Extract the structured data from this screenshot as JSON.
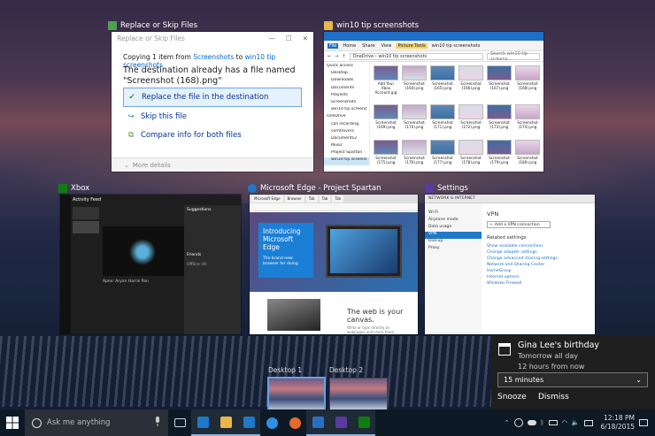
{
  "replace_dialog": {
    "caption": "Replace or Skip Files",
    "title": "Replace or Skip Files",
    "copy_prefix": "Copying 1 item from",
    "copy_from": "Screenshots",
    "copy_mid": "to",
    "copy_to": "win10 tip screenshots",
    "message": "The destination already has a file named \"Screenshot (168).png\"",
    "options": [
      "Replace the file in the destination",
      "Skip this file",
      "Compare info for both files"
    ],
    "more_details": "More details"
  },
  "explorer": {
    "caption": "win10 tip screenshots",
    "ribbon_tabs": [
      "File",
      "Home",
      "Share",
      "View",
      "Picture Tools"
    ],
    "ribbon_window_title": "win10 tip screenshots",
    "path": [
      "OneDrive",
      "win10 tip screenshots"
    ],
    "search_placeholder": "Search win10 tip screens...",
    "nav": [
      "Quick access",
      "Desktop",
      "Downloads",
      "Documents",
      "Playlists",
      "Screenshots",
      "win10 tip screens",
      "OneDrive",
      "call recording",
      "comtrovers",
      "Documents2",
      "Music",
      "Project Spartan",
      "win10 tip screens"
    ],
    "files": [
      "Add Your Xbox Account.jpg",
      "Screenshot (164).png",
      "Screenshot (165).png",
      "Screenshot (166).png",
      "Screenshot (167).png",
      "Screenshot (168).png",
      "Screenshot (169).png",
      "Screenshot (170).png",
      "Screenshot (171).png",
      "Screenshot (172).png",
      "Screenshot (173).png",
      "Screenshot (174).png",
      "Screenshot (175).png",
      "Screenshot (176).png",
      "Screenshot (177).png",
      "Screenshot (178).png",
      "Screenshot (179).png",
      "Screenshot (180).png"
    ]
  },
  "xbox": {
    "caption": "Xbox",
    "feed_title": "Activity Feed",
    "post_user": "Apex: Aryan Harris Pan",
    "side_title": "Suggestions",
    "friends_label": "Friends",
    "offline_label": "Offline (4)"
  },
  "edge": {
    "caption": "Microsoft Edge - Project Spartan",
    "tabs": [
      "Microsoft Edge",
      "Browser",
      "Tab",
      "Tab",
      "Tab"
    ],
    "hero_title": "Introducing Microsoft Edge",
    "hero_sub": "The brand new browser for doing",
    "canvas_title": "The web is your canvas.",
    "canvas_sub": "Write or type directly on webpages and share them"
  },
  "settings": {
    "caption": "Settings",
    "header": "NETWORK & INTERNET",
    "left": [
      "Wi-Fi",
      "Airplane mode",
      "Data usage",
      "VPN",
      "Dial-up",
      "Proxy"
    ],
    "selected_left": "VPN",
    "heading": "VPN",
    "add_button": "Add a VPN connection",
    "related_heading": "Related settings",
    "links": [
      "Show available connections",
      "Change adapter settings",
      "Change advanced sharing settings",
      "Network and Sharing Center",
      "HomeGroup",
      "Internet options",
      "Windows Firewall"
    ]
  },
  "desktops": [
    {
      "label": "Desktop 1",
      "current": true
    },
    {
      "label": "Desktop 2",
      "current": false
    }
  ],
  "notification": {
    "title": "Gina Lee's birthday",
    "line1": "Tomorrow all day",
    "line2": "12 hours from now",
    "snooze_value": "15 minutes",
    "snooze_button": "Snooze",
    "dismiss_button": "Dismiss"
  },
  "taskbar": {
    "search_placeholder": "Ask me anything",
    "apps": [
      {
        "icon": "task-view-icon",
        "color": "#cfd8e3"
      },
      {
        "icon": "edge-preview-icon",
        "color": "#1f78c8"
      },
      {
        "icon": "file-explorer-icon",
        "color": "#e8b84a"
      },
      {
        "icon": "store-icon",
        "color": "#1f78c8"
      },
      {
        "icon": "edge-icon",
        "color": "#2f8fe0"
      },
      {
        "icon": "firefox-icon",
        "color": "#e66a2c"
      },
      {
        "icon": "mail-icon",
        "color": "#2a6fc6"
      },
      {
        "icon": "settings-icon",
        "color": "#5a3aa0"
      },
      {
        "icon": "xbox-icon",
        "color": "#107c10"
      }
    ],
    "time": "12:18 PM",
    "date": "6/18/2015"
  }
}
